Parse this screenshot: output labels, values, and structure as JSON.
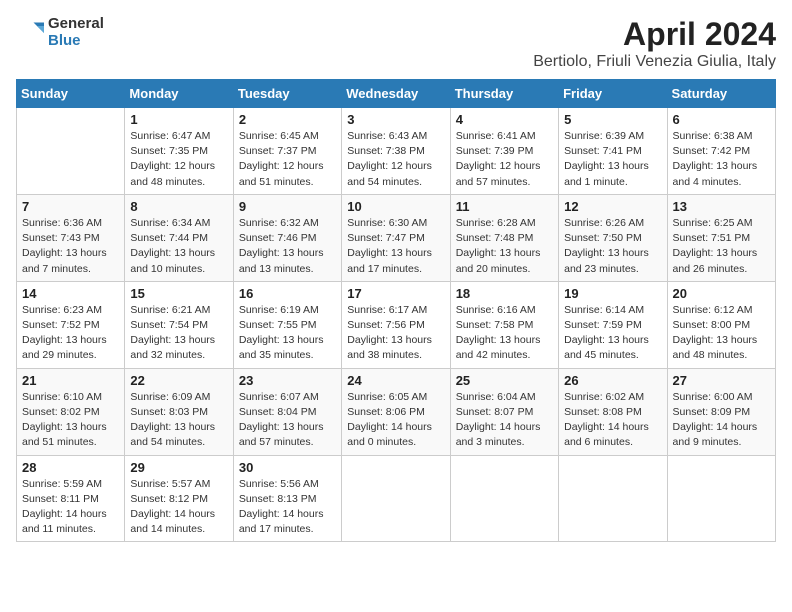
{
  "header": {
    "title": "April 2024",
    "subtitle": "Bertiolo, Friuli Venezia Giulia, Italy",
    "logo_line1": "General",
    "logo_line2": "Blue"
  },
  "days_of_week": [
    "Sunday",
    "Monday",
    "Tuesday",
    "Wednesday",
    "Thursday",
    "Friday",
    "Saturday"
  ],
  "weeks": [
    [
      {
        "num": "",
        "info": ""
      },
      {
        "num": "1",
        "info": "Sunrise: 6:47 AM\nSunset: 7:35 PM\nDaylight: 12 hours and 48 minutes."
      },
      {
        "num": "2",
        "info": "Sunrise: 6:45 AM\nSunset: 7:37 PM\nDaylight: 12 hours and 51 minutes."
      },
      {
        "num": "3",
        "info": "Sunrise: 6:43 AM\nSunset: 7:38 PM\nDaylight: 12 hours and 54 minutes."
      },
      {
        "num": "4",
        "info": "Sunrise: 6:41 AM\nSunset: 7:39 PM\nDaylight: 12 hours and 57 minutes."
      },
      {
        "num": "5",
        "info": "Sunrise: 6:39 AM\nSunset: 7:41 PM\nDaylight: 13 hours and 1 minute."
      },
      {
        "num": "6",
        "info": "Sunrise: 6:38 AM\nSunset: 7:42 PM\nDaylight: 13 hours and 4 minutes."
      }
    ],
    [
      {
        "num": "7",
        "info": "Sunrise: 6:36 AM\nSunset: 7:43 PM\nDaylight: 13 hours and 7 minutes."
      },
      {
        "num": "8",
        "info": "Sunrise: 6:34 AM\nSunset: 7:44 PM\nDaylight: 13 hours and 10 minutes."
      },
      {
        "num": "9",
        "info": "Sunrise: 6:32 AM\nSunset: 7:46 PM\nDaylight: 13 hours and 13 minutes."
      },
      {
        "num": "10",
        "info": "Sunrise: 6:30 AM\nSunset: 7:47 PM\nDaylight: 13 hours and 17 minutes."
      },
      {
        "num": "11",
        "info": "Sunrise: 6:28 AM\nSunset: 7:48 PM\nDaylight: 13 hours and 20 minutes."
      },
      {
        "num": "12",
        "info": "Sunrise: 6:26 AM\nSunset: 7:50 PM\nDaylight: 13 hours and 23 minutes."
      },
      {
        "num": "13",
        "info": "Sunrise: 6:25 AM\nSunset: 7:51 PM\nDaylight: 13 hours and 26 minutes."
      }
    ],
    [
      {
        "num": "14",
        "info": "Sunrise: 6:23 AM\nSunset: 7:52 PM\nDaylight: 13 hours and 29 minutes."
      },
      {
        "num": "15",
        "info": "Sunrise: 6:21 AM\nSunset: 7:54 PM\nDaylight: 13 hours and 32 minutes."
      },
      {
        "num": "16",
        "info": "Sunrise: 6:19 AM\nSunset: 7:55 PM\nDaylight: 13 hours and 35 minutes."
      },
      {
        "num": "17",
        "info": "Sunrise: 6:17 AM\nSunset: 7:56 PM\nDaylight: 13 hours and 38 minutes."
      },
      {
        "num": "18",
        "info": "Sunrise: 6:16 AM\nSunset: 7:58 PM\nDaylight: 13 hours and 42 minutes."
      },
      {
        "num": "19",
        "info": "Sunrise: 6:14 AM\nSunset: 7:59 PM\nDaylight: 13 hours and 45 minutes."
      },
      {
        "num": "20",
        "info": "Sunrise: 6:12 AM\nSunset: 8:00 PM\nDaylight: 13 hours and 48 minutes."
      }
    ],
    [
      {
        "num": "21",
        "info": "Sunrise: 6:10 AM\nSunset: 8:02 PM\nDaylight: 13 hours and 51 minutes."
      },
      {
        "num": "22",
        "info": "Sunrise: 6:09 AM\nSunset: 8:03 PM\nDaylight: 13 hours and 54 minutes."
      },
      {
        "num": "23",
        "info": "Sunrise: 6:07 AM\nSunset: 8:04 PM\nDaylight: 13 hours and 57 minutes."
      },
      {
        "num": "24",
        "info": "Sunrise: 6:05 AM\nSunset: 8:06 PM\nDaylight: 14 hours and 0 minutes."
      },
      {
        "num": "25",
        "info": "Sunrise: 6:04 AM\nSunset: 8:07 PM\nDaylight: 14 hours and 3 minutes."
      },
      {
        "num": "26",
        "info": "Sunrise: 6:02 AM\nSunset: 8:08 PM\nDaylight: 14 hours and 6 minutes."
      },
      {
        "num": "27",
        "info": "Sunrise: 6:00 AM\nSunset: 8:09 PM\nDaylight: 14 hours and 9 minutes."
      }
    ],
    [
      {
        "num": "28",
        "info": "Sunrise: 5:59 AM\nSunset: 8:11 PM\nDaylight: 14 hours and 11 minutes."
      },
      {
        "num": "29",
        "info": "Sunrise: 5:57 AM\nSunset: 8:12 PM\nDaylight: 14 hours and 14 minutes."
      },
      {
        "num": "30",
        "info": "Sunrise: 5:56 AM\nSunset: 8:13 PM\nDaylight: 14 hours and 17 minutes."
      },
      {
        "num": "",
        "info": ""
      },
      {
        "num": "",
        "info": ""
      },
      {
        "num": "",
        "info": ""
      },
      {
        "num": "",
        "info": ""
      }
    ]
  ]
}
